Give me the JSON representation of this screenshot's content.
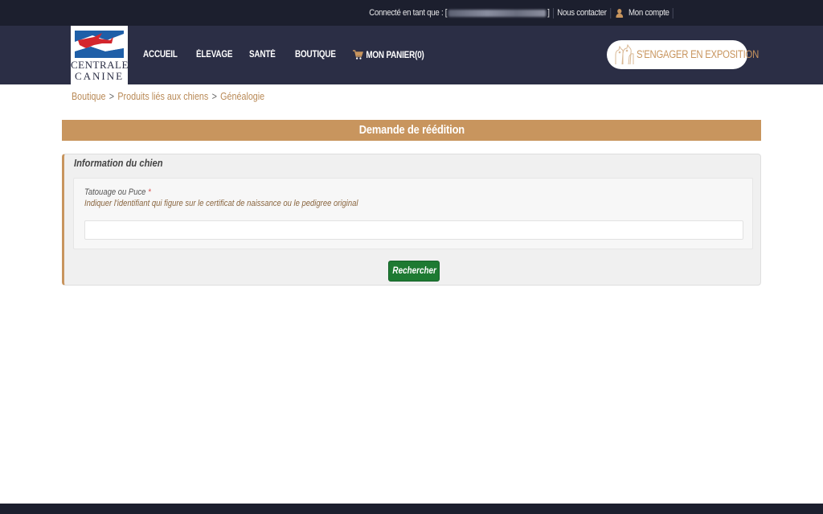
{
  "topbar": {
    "connected_prefix": "Connecté en tant que : [",
    "connected_suffix": "]",
    "contact_label": "Nous contacter",
    "account_label": "Mon compte",
    "user_icon": "user-icon"
  },
  "brand": {
    "line1": "CENTRALE",
    "line2": "CANINE",
    "colors": {
      "blue": "#1f5fa8",
      "red": "#d3262d",
      "navy": "#2b2e45"
    }
  },
  "nav": {
    "items": [
      {
        "label": "ACCUEIL"
      },
      {
        "label": "ÉLEVAGE"
      },
      {
        "label": "SANTÉ"
      },
      {
        "label": "BOUTIQUE"
      },
      {
        "label": "MON PANIER(0)",
        "icon": "cart-icon"
      }
    ],
    "engage_label": "S'ENGAGER EN EXPOSITION",
    "engage_icon": "dogs-icon"
  },
  "breadcrumb": {
    "items": [
      "Boutique",
      "Produits liés aux chiens",
      "Généalogie"
    ],
    "separator": ">"
  },
  "page": {
    "title": "Demande de réédition"
  },
  "form": {
    "section_title": "Information du chien",
    "field_label": "Tatouage ou Puce",
    "required_mark": "*",
    "field_hint": "Indiquer l'identifiant qui figure sur le certificat de naissance ou le pedigree original",
    "field_value": "",
    "search_button": "Rechercher"
  },
  "colors": {
    "accent": "#c8955e",
    "dark": "#1c1f2e",
    "nav_bg": "#2b2e45",
    "button_green": "#1e7a32"
  }
}
